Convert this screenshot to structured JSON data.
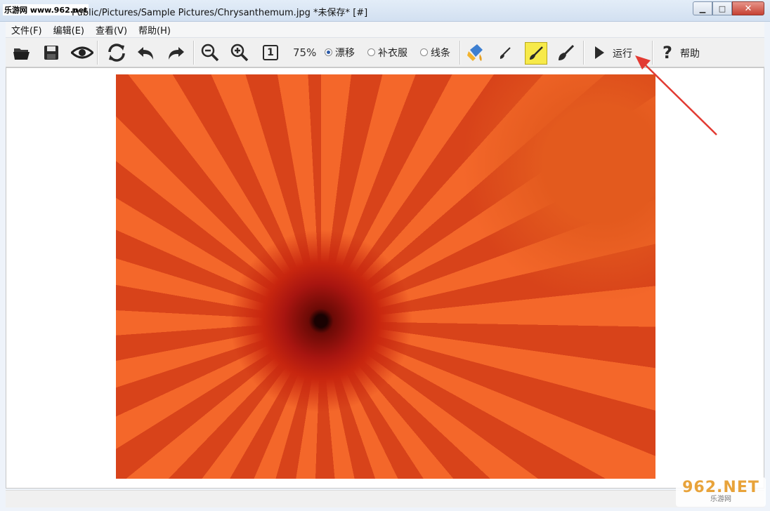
{
  "window": {
    "site_watermark": "乐游网 www.962.net",
    "title": "Public/Pictures/Sample Pictures/Chrysanthemum.jpg  *未保存* [#]",
    "minimize_glyph": "▁",
    "maximize_glyph": "□",
    "close_glyph": "✕"
  },
  "menu": [
    "文件(F)",
    "编辑(E)",
    "查看(V)",
    "帮助(H)"
  ],
  "toolbar": {
    "icons": [
      "open-folder-icon",
      "save-disk-icon",
      "preview-eye-icon",
      "refresh-icon",
      "undo-icon",
      "redo-icon",
      "zoom-out-icon",
      "zoom-in-icon",
      "actual-size-icon",
      "paint-bucket-icon",
      "brush-small-icon",
      "brush-highlight-icon",
      "brush-large-icon",
      "play-icon",
      "help-question-icon"
    ],
    "actual_size_label": "1",
    "zoom_percent": "75%",
    "modes": [
      {
        "label": "漂移",
        "checked": true
      },
      {
        "label": "补衣服",
        "checked": false
      },
      {
        "label": "线条",
        "checked": false
      }
    ],
    "run_label": "运行",
    "help_label": "帮助",
    "highlight_color": "#f7ea4a"
  },
  "canvas": {
    "image_name": "Chrysanthemum.jpg",
    "accent_color": "#e4501d"
  },
  "annotation": {
    "arrow_color": "#e23a32"
  },
  "corner_logo": {
    "main": "962.NET",
    "sub": "乐游网"
  }
}
